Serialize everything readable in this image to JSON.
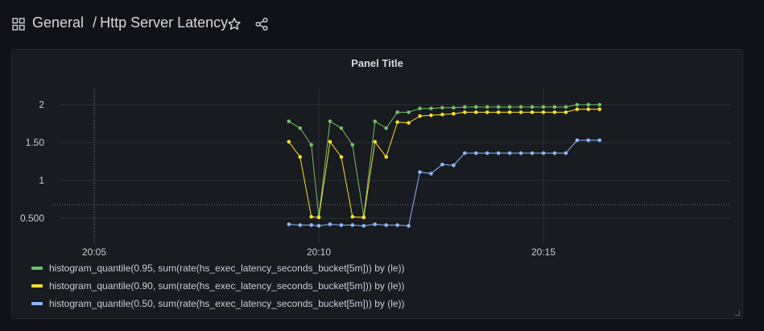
{
  "header": {
    "folder": "General",
    "separator": "/",
    "dashboard_title": "Http Server Latency",
    "icons": [
      "grid-icon",
      "star-icon",
      "share-icon"
    ]
  },
  "panel": {
    "title": "Panel Title"
  },
  "chart_data": {
    "type": "line",
    "x_ticks": [
      "20:05",
      "20:10",
      "20:15"
    ],
    "y_ticks": [
      "0.500",
      "1",
      "1.50",
      "2"
    ],
    "ylim": [
      0.35,
      2.2
    ],
    "grid": true,
    "legend_position": "bottom-left",
    "x": [
      "20:09:20",
      "20:09:35",
      "20:09:50",
      "20:10:00",
      "20:10:15",
      "20:10:30",
      "20:10:45",
      "20:11:00",
      "20:11:15",
      "20:11:30",
      "20:11:45",
      "20:12:00",
      "20:12:15",
      "20:12:30",
      "20:12:45",
      "20:13:00",
      "20:13:15",
      "20:13:30",
      "20:13:45",
      "20:14:00",
      "20:14:15",
      "20:14:30",
      "20:14:45",
      "20:15:00",
      "20:15:15",
      "20:15:30",
      "20:15:45",
      "20:16:00",
      "20:16:15"
    ],
    "series": [
      {
        "name": "histogram_quantile(0.95, sum(rate(hs_exec_latency_seconds_bucket[5m])) by (le))",
        "color": "#73bf69",
        "values": [
          1.78,
          1.69,
          1.47,
          0.52,
          1.78,
          1.69,
          1.47,
          0.52,
          1.78,
          1.69,
          1.9,
          1.9,
          1.95,
          1.95,
          1.96,
          1.96,
          1.97,
          1.97,
          1.97,
          1.97,
          1.97,
          1.97,
          1.97,
          1.97,
          1.97,
          1.97,
          2.0,
          2.0,
          2.0
        ]
      },
      {
        "name": "histogram_quantile(0.90, sum(rate(hs_exec_latency_seconds_bucket[5m])) by (le))",
        "color": "#fade2a",
        "values": [
          1.51,
          1.31,
          0.52,
          0.51,
          1.51,
          1.31,
          0.52,
          0.51,
          1.51,
          1.31,
          1.77,
          1.76,
          1.85,
          1.86,
          1.87,
          1.88,
          1.9,
          1.9,
          1.9,
          1.9,
          1.9,
          1.9,
          1.9,
          1.9,
          1.9,
          1.9,
          1.94,
          1.94,
          1.94
        ]
      },
      {
        "name": "histogram_quantile(0.50, sum(rate(hs_exec_latency_seconds_bucket[5m])) by (le))",
        "color": "#8ab8ff",
        "values": [
          0.42,
          0.41,
          0.41,
          0.4,
          0.42,
          0.41,
          0.41,
          0.4,
          0.42,
          0.41,
          0.41,
          0.4,
          1.11,
          1.09,
          1.21,
          1.2,
          1.36,
          1.36,
          1.36,
          1.36,
          1.36,
          1.36,
          1.36,
          1.36,
          1.36,
          1.36,
          1.53,
          1.53,
          1.53
        ]
      }
    ],
    "threshold_value": 0.68
  }
}
